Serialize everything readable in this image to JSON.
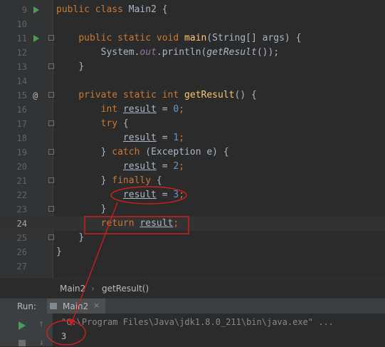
{
  "editor": {
    "current_line": 24,
    "lines": [
      {
        "n": "9"
      },
      {
        "n": "10"
      },
      {
        "n": "11"
      },
      {
        "n": "12"
      },
      {
        "n": "13"
      },
      {
        "n": "14"
      },
      {
        "n": "15"
      },
      {
        "n": "16"
      },
      {
        "n": "17"
      },
      {
        "n": "18"
      },
      {
        "n": "19"
      },
      {
        "n": "20"
      },
      {
        "n": "21"
      },
      {
        "n": "22"
      },
      {
        "n": "23"
      },
      {
        "n": "24"
      },
      {
        "n": "25"
      },
      {
        "n": "26"
      },
      {
        "n": "27"
      }
    ],
    "code": {
      "l9_public": "public",
      "l9_class": "class",
      "l9_name": "Main2 {",
      "l11_public": "public",
      "l11_static": "static",
      "l11_void": "void",
      "l11_main": "main",
      "l11_rest": "(String[] args) {",
      "l12_system": "System.",
      "l12_out": "out",
      "l12_println": ".println(",
      "l12_getresult": "getResult",
      "l12_end": "());",
      "l13_brace": "}",
      "l15_private": "private",
      "l15_static": "static",
      "l15_int": "int",
      "l15_get": "getResult",
      "l15_rest": "() {",
      "l16_int": "int",
      "l16_var": "result",
      "l16_eq": " = ",
      "l16_num": "0",
      "l16_semi": ";",
      "l17_try": "try",
      "l17_brace": " {",
      "l18_var": "result",
      "l18_eq": " = ",
      "l18_num": "1",
      "l18_semi": ";",
      "l19_close": "} ",
      "l19_catch": "catch",
      "l19_rest": " (Exception e) {",
      "l20_var": "result",
      "l20_eq": " = ",
      "l20_num": "2",
      "l20_semi": ";",
      "l21_close": "} ",
      "l21_finally": "finally",
      "l21_brace": " {",
      "l22_var": "result",
      "l22_eq": " = ",
      "l22_num": "3",
      "l22_semi": ";",
      "l23_brace": "}",
      "l24_return": "return",
      "l24_var": "result",
      "l24_semi": ";",
      "l25_brace": "}",
      "l26_brace": "}"
    }
  },
  "breadcrumb": {
    "class_name": "Main2",
    "separator": "›",
    "method": "getResult()"
  },
  "run_panel": {
    "label": "Run:",
    "tab_label": "Main2",
    "tab_close": "×",
    "command": "\"C:\\Program Files\\Java\\jdk1.8.0_211\\bin\\java.exe\" ...",
    "output": "3",
    "up_glyph": "↑",
    "down_glyph": "↓"
  },
  "gutter_marks": {
    "at": "@"
  },
  "colors": {
    "background": "#2b2b2b",
    "keyword": "#cc7832",
    "method": "#ffc66d",
    "number": "#6897bb",
    "static_field": "#9876aa",
    "annotation_red": "#d11f1f",
    "run_green": "#499c54"
  },
  "icons": [
    "run-gutter-icon",
    "fold-icon",
    "override-at-icon",
    "rerun-icon",
    "stop-icon",
    "scroll-up-icon",
    "scroll-down-icon",
    "run-config-icon",
    "close-tab-icon"
  ]
}
